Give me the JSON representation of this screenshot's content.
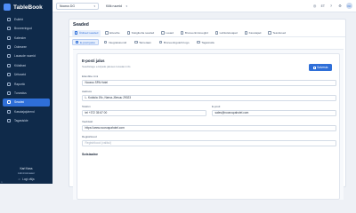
{
  "app": {
    "brand": "TableBook"
  },
  "sidebar": {
    "items": [
      {
        "label": "Esileht",
        "icon": "home-icon"
      },
      {
        "label": "Broneeringud",
        "icon": "calendar-icon"
      },
      {
        "label": "Kalender",
        "icon": "calendar-grid-icon"
      },
      {
        "label": "Ooteseen",
        "icon": "clock-icon"
      },
      {
        "label": "Lauaude ruumid",
        "icon": "table-icon"
      },
      {
        "label": "Külalised",
        "icon": "users-icon"
      },
      {
        "label": "Ürituseid",
        "icon": "event-icon"
      },
      {
        "label": "Raportid",
        "icon": "chart-icon"
      },
      {
        "label": "Turundus",
        "icon": "megaphone-icon"
      },
      {
        "label": "Seaded",
        "icon": "gear-icon"
      },
      {
        "label": "Kasutajajuhend",
        "icon": "book-icon"
      },
      {
        "label": "Tagasiside",
        "icon": "feedback-icon"
      }
    ],
    "active_index": 9,
    "footer": {
      "user_name": "Karl Kass",
      "user_role": "Administraator",
      "logout": "Logi välja"
    },
    "corner": "n"
  },
  "topbar": {
    "hotel_select": "Noorus DG",
    "date_select": "Kõik ruumid",
    "right_label": "ET",
    "avatar_initials": "KK"
  },
  "page": {
    "title": "Seaded",
    "tabs_primary": [
      {
        "label": "Üldised seaded",
        "icon": "settings-icon"
      },
      {
        "label": "Ettevõte",
        "icon": "building-icon"
      },
      {
        "label": "Söögikoha seaded",
        "icon": "restaurant-icon"
      },
      {
        "label": "Lauad",
        "icon": "table-icon"
      },
      {
        "label": "Broneerimisreeglid",
        "icon": "rules-icon"
      },
      {
        "label": "Lahtiolekuajad",
        "icon": "clock-icon"
      },
      {
        "label": "Kasutajad",
        "icon": "users-icon"
      },
      {
        "label": "Teavitused",
        "icon": "bell-icon"
      }
    ],
    "tabs_primary_active": 0,
    "tabs_secondary": [
      {
        "label": "E-posti jalus",
        "icon": "mail-icon"
      },
      {
        "label": "Integratsioonid",
        "icon": "plug-icon"
      },
      {
        "label": "Tarnetaan",
        "icon": "truck-icon"
      },
      {
        "label": "Broneeringuleht logo",
        "icon": "image-icon"
      },
      {
        "label": "Tagasiside",
        "icon": "feedback-icon"
      }
    ],
    "tabs_secondary_active": 0
  },
  "form": {
    "title": "E-posti jalus",
    "subtitle": "Seadistage e-kirjade jaluses kuvatav info",
    "save_label": "Salvesta",
    "fields": {
      "company_name": {
        "label": "Ettevõtte nimi",
        "value": "Noorus SPA Hotel"
      },
      "address": {
        "label": "Aadress",
        "value": "L. Koidula 19c, Narva-Jõesuu 29023"
      },
      "phone": {
        "label": "Telefon",
        "value": "tel +372 35 67 00"
      },
      "email": {
        "label": "E-posti",
        "value": "sales@nooruspahotel.com"
      },
      "website": {
        "label": "Veebisait",
        "value": "https://www.nooruspahotel.com"
      },
      "registry": {
        "label": "Registrikood",
        "value": "",
        "placeholder": "Registrikood (valikul)"
      }
    },
    "next_section": "Sotsiaalne"
  }
}
